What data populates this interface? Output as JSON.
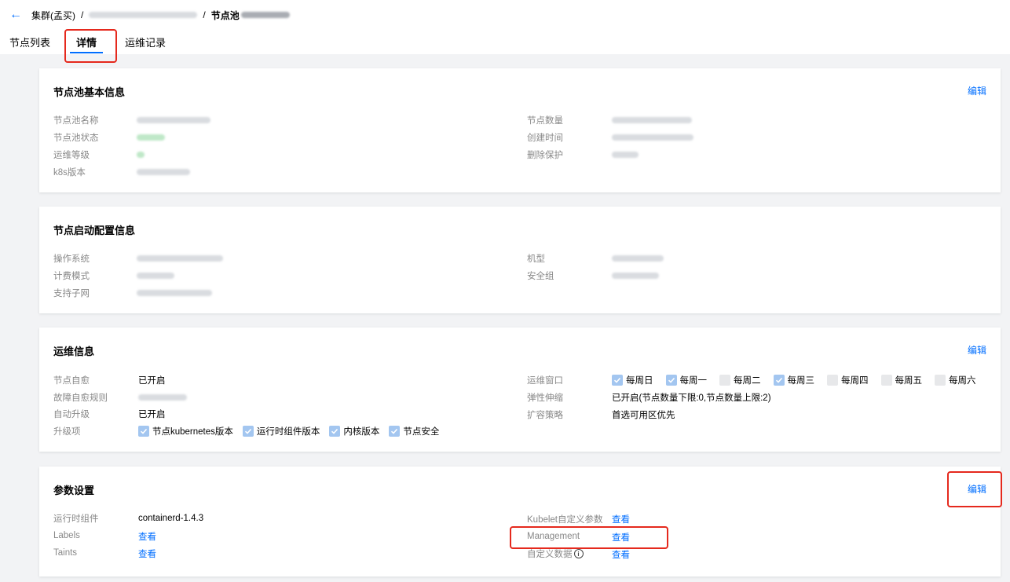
{
  "breadcrumb": {
    "cluster": "集群(孟买)",
    "sep1": "/",
    "sep2": "/",
    "nodepool_prefix": "节点池"
  },
  "tabs": [
    "节点列表",
    "详情",
    "运维记录"
  ],
  "basic": {
    "title": "节点池基本信息",
    "edit": "编辑",
    "left_labels": [
      "节点池名称",
      "节点池状态",
      "运维等级",
      "k8s版本"
    ],
    "right_labels": [
      "节点数量",
      "创建时间",
      "删除保护"
    ]
  },
  "launch": {
    "title": "节点启动配置信息",
    "left_labels": [
      "操作系统",
      "计费模式",
      "支持子网"
    ],
    "right_labels": [
      "机型",
      "安全组"
    ]
  },
  "ops": {
    "title": "运维信息",
    "edit": "编辑",
    "self_heal_label": "节点自愈",
    "self_heal_value": "已开启",
    "heal_rule_label": "故障自愈规则",
    "auto_upgrade_label": "自动升级",
    "auto_upgrade_value": "已开启",
    "upgrade_items_label": "升级项",
    "upgrade_items": [
      "节点kubernetes版本",
      "运行时组件版本",
      "内核版本",
      "节点安全"
    ],
    "window_label": "运维窗口",
    "days": [
      {
        "label": "每周日",
        "checked": true
      },
      {
        "label": "每周一",
        "checked": true
      },
      {
        "label": "每周二",
        "checked": false
      },
      {
        "label": "每周三",
        "checked": true
      },
      {
        "label": "每周四",
        "checked": false
      },
      {
        "label": "每周五",
        "checked": false
      },
      {
        "label": "每周六",
        "checked": false
      }
    ],
    "scaling_label": "弹性伸缩",
    "scaling_value": "已开启(节点数量下限:0,节点数量上限:2)",
    "expand_label": "扩容策略",
    "expand_value": "首选可用区优先"
  },
  "params": {
    "title": "参数设置",
    "edit": "编辑",
    "runtime_label": "运行时组件",
    "runtime_value": "containerd-1.4.3",
    "labels_label": "Labels",
    "taints_label": "Taints",
    "kubelet_label": "Kubelet自定义参数",
    "management_label": "Management",
    "custom_data_label": "自定义数据",
    "view": "查看"
  },
  "colors": {
    "accent": "#006eff",
    "highlight": "#e5291d"
  }
}
